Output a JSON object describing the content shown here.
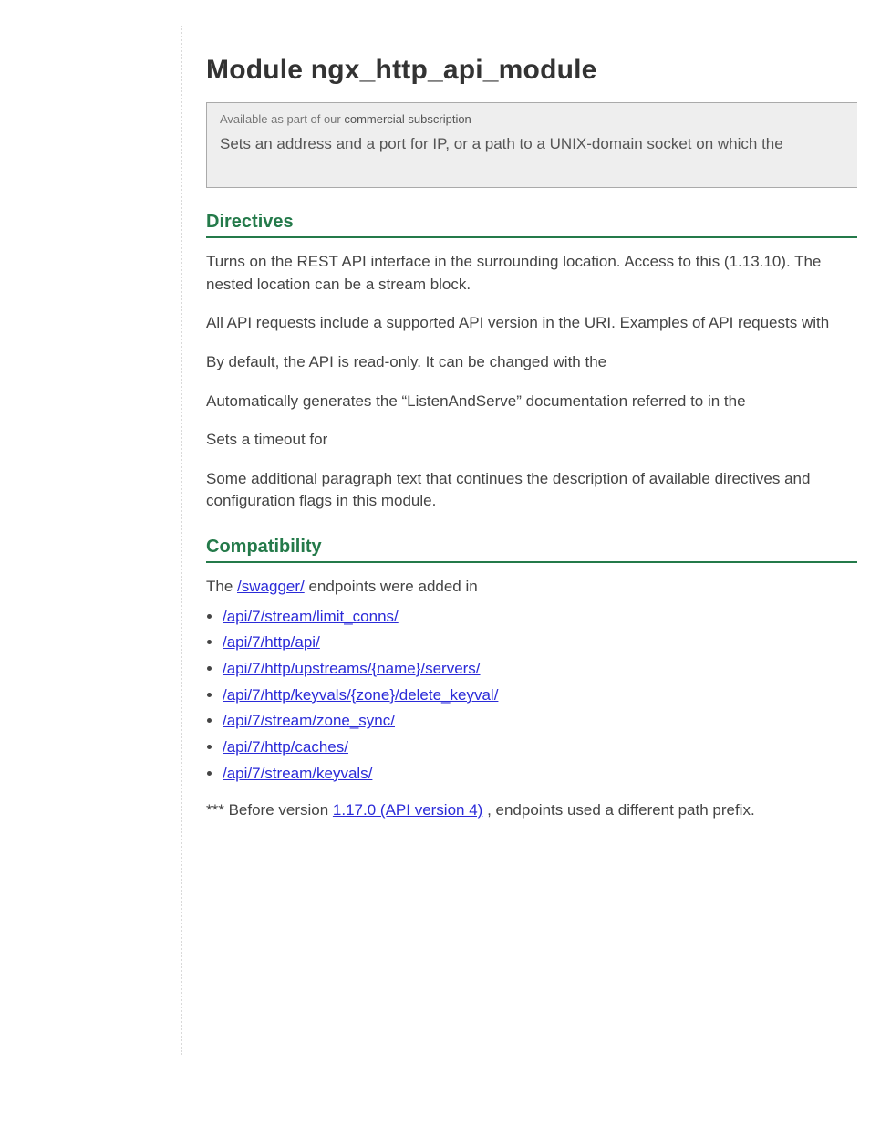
{
  "title": "Module ngx_http_api_module",
  "box": {
    "field_label": "Available as part of our",
    "field_value": "commercial subscription",
    "lead": "Sets an address and a port for IP, or a path to a UNIX-domain socket on which the"
  },
  "sections": [
    {
      "heading": "Directives",
      "paragraphs": [
        "Turns on the REST API interface in the surrounding location. Access to this (1.13.10). The nested location can be a stream block.",
        "All API requests include a supported API version in the URI. Examples of API requests with",
        "By default, the API is read-only. It can be changed with the",
        "Automatically generates the “ListenAndServe” documentation referred to in the",
        "Sets a timeout for",
        "Some additional paragraph text that continues the description of available directives and configuration flags in this module."
      ]
    },
    {
      "heading": "Compatibility",
      "intro_prefix": "The",
      "intro_link": "/swagger/",
      "intro_suffix": "endpoints were added in",
      "links": [
        "/api/7/stream/limit_conns/",
        "/api/7/http/api/",
        "/api/7/http/upstreams/{name}/servers/",
        "/api/7/http/keyvals/{zone}/delete_keyval/",
        "/api/7/stream/zone_sync/",
        "/api/7/http/caches/",
        "/api/7/stream/keyvals/"
      ],
      "footnote_prefix": "*** Before version",
      "footnote_link": "1.17.0 (API version 4)",
      "footnote_suffix": ", endpoints used a different path prefix."
    }
  ]
}
